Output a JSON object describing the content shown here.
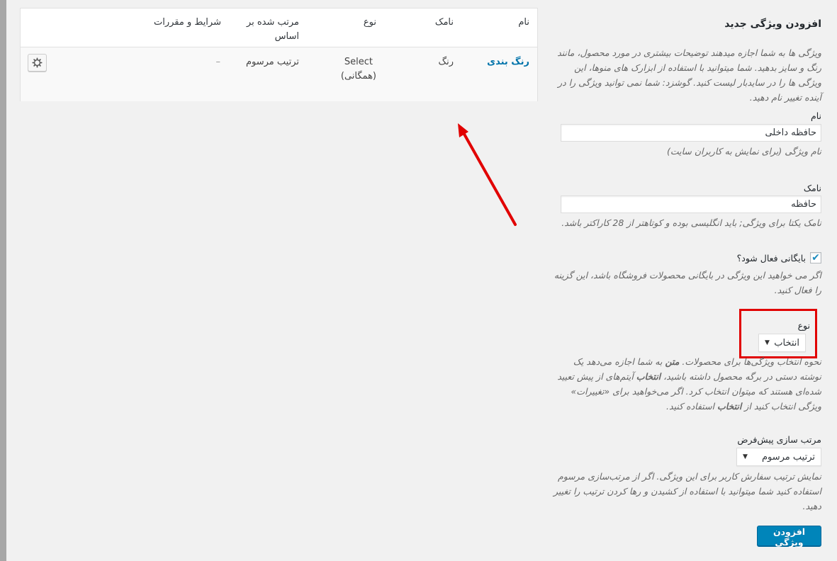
{
  "table": {
    "headers": {
      "name": "نام",
      "slug": "نامک",
      "type": "نوع",
      "order_by": "مرتب شده بر اساس",
      "terms": "شرایط و مقررات"
    },
    "rows": [
      {
        "name": "رنگ بندی",
        "slug": "رنگ",
        "type_line1": "Select",
        "type_line2": "(همگانی)",
        "order_by": "ترتیب مرسوم",
        "terms": "–"
      }
    ],
    "row_action_icon": "gear-icon"
  },
  "form": {
    "title": "افزودن ویژگی جدید",
    "intro": "ویژگی ها به شما اجازه میدهند توضیحات بیشتری در مورد محصول، مانند رنگ و سایز بدهید. شما میتوانید با استفاده از ابزارک های منوها، این ویژگی ها را در سایدبار لیست کنید. گوشزد: شما نمی توانید ویژگی را در آینده تغییر نام دهید.",
    "name": {
      "label": "نام",
      "value": "حافظه داخلی",
      "hint": "نام ویژگی (برای نمایش به کاربران سایت)"
    },
    "slug": {
      "label": "نامک",
      "value": "حافظه",
      "hint": "نامک یکتا برای ویژگی; باید انگلیسی بوده و کوتاهتر از 28 کاراکتر باشد."
    },
    "archive": {
      "label": "بایگانی فعال شود؟",
      "checked": true,
      "hint": "اگر می خواهید این ویژگی در بایگانی محصولات فروشگاه باشد، این گزینه را فعال کنید."
    },
    "type": {
      "label": "نوع",
      "selected": "انتخاب",
      "hint_p1": "نحوه انتخاب ویژگی‌ها برای محصولات.",
      "hint_b1": "متن",
      "hint_p2": "به شما اجازه می‌دهد یک نوشته دستی در برگه محصول داشته باشید،",
      "hint_b2": "انتخاب",
      "hint_p3": "آیتم‌های از پیش تعیید شده‌ای هستند که میتوان انتخاب کرد. اگر می‌خواهید برای «تغییرات» ویژگی انتخاب کنید از",
      "hint_b3": "انتخاب",
      "hint_p4": "استفاده کنید."
    },
    "ordering": {
      "label": "مرتب سازی پیش‌فرض",
      "selected": "ترتیب مرسوم",
      "hint": "نمایش ترتیب سفارش کاربر برای این ویژگی. اگر از مرتب‌سازی مرسوم استفاده کنید شما میتوانید با استفاده از کشیدن و رها کردن ترتیب را تغییر دهید."
    },
    "submit_label": "افزودن ویژگی"
  },
  "colors": {
    "accent": "#0085ba",
    "link": "#0073aa",
    "highlight_box": "#e10000",
    "arrow": "#e10000"
  }
}
